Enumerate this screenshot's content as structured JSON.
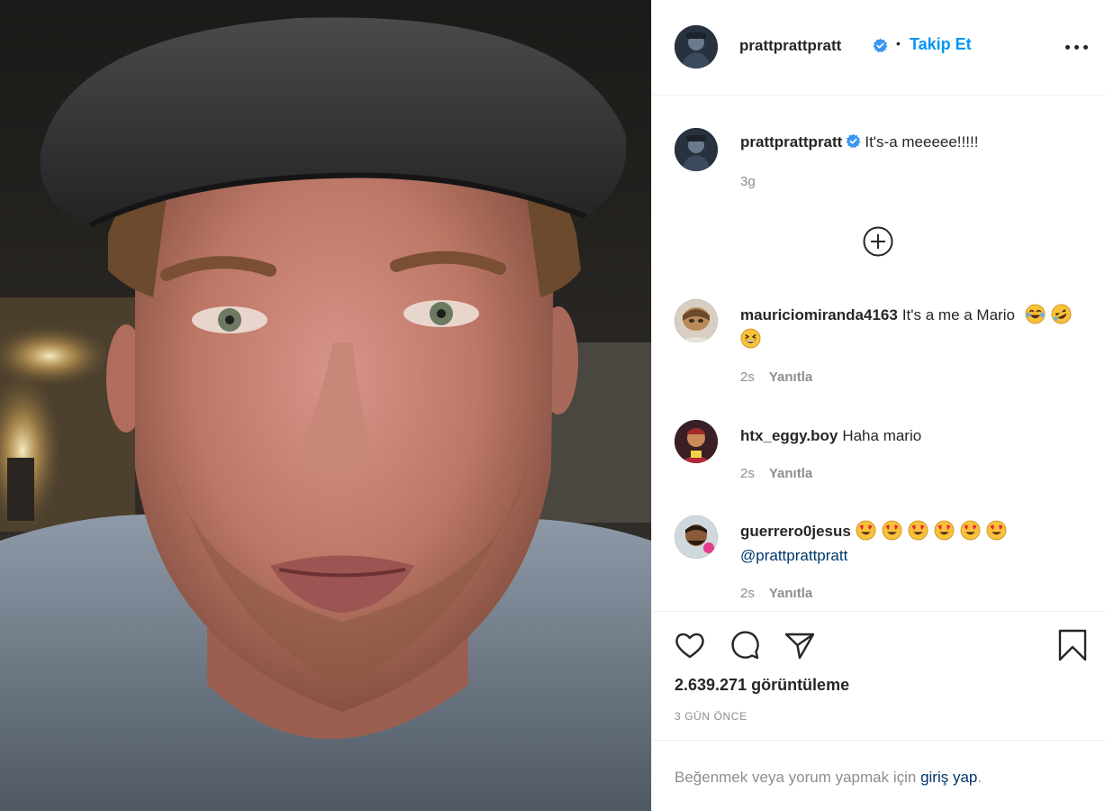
{
  "post": {
    "author": "prattprattpratt",
    "follow_label": "Takip Et",
    "separator": "•",
    "caption": "It's-a meeeee!!!!!",
    "caption_time": "3g"
  },
  "comments": [
    {
      "user": "mauriciomiranda4163",
      "text": "It's a me a Mario",
      "emojis": [
        "laugh-tears-emoji",
        "rofl-emoji",
        "grin-squint-emoji"
      ],
      "time": "2s",
      "reply_label": "Yanıtla"
    },
    {
      "user": "htx_eggy.boy",
      "text": "Haha mario",
      "time": "2s",
      "reply_label": "Yanıtla"
    },
    {
      "user": "guerrero0jesus",
      "emojis": [
        "heart-eyes-emoji",
        "heart-eyes-emoji",
        "heart-eyes-emoji",
        "heart-eyes-emoji",
        "heart-eyes-emoji",
        "heart-eyes-emoji"
      ],
      "mention": "@prattprattpratt",
      "time": "2s",
      "reply_label": "Yanıtla"
    }
  ],
  "stats": {
    "views": "2.639.271 görüntüleme",
    "posted_ago": "3 GÜN ÖNCE"
  },
  "login": {
    "prefix": "Beğenmek veya yorum yapmak için",
    "link": "giriş yap",
    "suffix": "."
  },
  "icons": {
    "like": "heart-icon",
    "comment": "comment-bubble-icon",
    "share": "paper-plane-icon",
    "save": "bookmark-icon",
    "more": "more-options-icon",
    "load_more": "plus-circle-icon",
    "verified": "verified-badge-icon"
  },
  "colors": {
    "link_blue": "#0095f6",
    "verified_blue": "#3897f0",
    "muted_text": "#8e8e8e",
    "text": "#262626",
    "divider": "#efefef"
  }
}
